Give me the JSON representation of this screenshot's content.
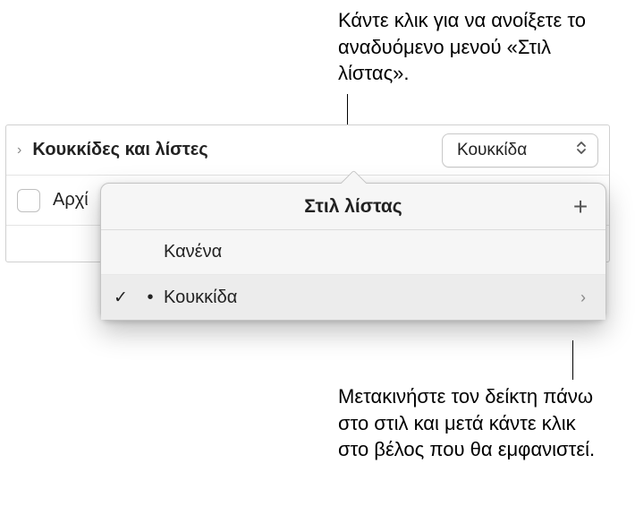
{
  "callouts": {
    "top": "Κάντε κλικ για να ανοίξετε το αναδυόμενο μενού «Στιλ λίστας».",
    "bottom": "Μετακινήστε τον δείκτη πάνω στο στιλ και μετά κάντε κλικ στο βέλος που θα εμφανιστεί."
  },
  "section": {
    "label": "Κουκκίδες και λίστες",
    "popup_value": "Κουκκίδα",
    "row2_label": "Αρχί"
  },
  "popover": {
    "title": "Στιλ λίστας",
    "add_glyph": "+",
    "items": [
      {
        "label": "Κανένα",
        "selected": false,
        "has_arrow": false
      },
      {
        "label": "Κουκκίδα",
        "selected": true,
        "has_arrow": true
      }
    ]
  },
  "glyphs": {
    "disclosure_right": "›",
    "chevron_updown": "⌵",
    "checkmark": "✓",
    "bullet": "•",
    "arrow_right": "›"
  }
}
